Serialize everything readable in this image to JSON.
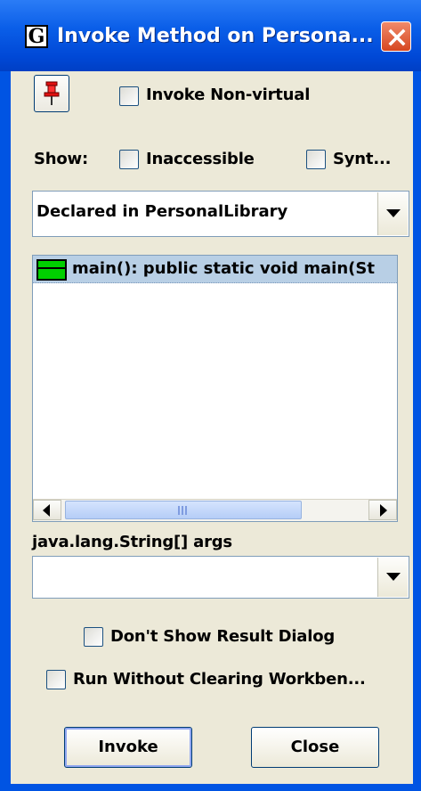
{
  "window": {
    "title": "Invoke Method on Persona...",
    "app_icon_glyph": "G"
  },
  "toolbar": {
    "pin_icon": "pushpin-icon",
    "invoke_nonvirtual_label": "Invoke Non-virtual",
    "invoke_nonvirtual_checked": false
  },
  "show": {
    "label": "Show:",
    "inaccessible_label": "Inaccessible",
    "inaccessible_checked": false,
    "synthetic_label": "Synt...",
    "synthetic_checked": false
  },
  "declared_combo": {
    "selected": "Declared in PersonalLibrary"
  },
  "methods": {
    "items": [
      {
        "icon": "method-icon",
        "label": "main():  public static void main(St"
      }
    ]
  },
  "args": {
    "label": "java.lang.String[] args",
    "value": ""
  },
  "options": {
    "dont_show_result_label": "Don't Show Result Dialog",
    "dont_show_result_checked": false,
    "run_without_clearing_label": "Run Without Clearing Workben...",
    "run_without_clearing_checked": false
  },
  "buttons": {
    "invoke": "Invoke",
    "close": "Close"
  },
  "colors": {
    "titlebar": "#0054e3",
    "dialog_bg": "#ece9d8",
    "selection": "#b8cfe5",
    "method_icon": "#00d000",
    "close_button": "#e0552f"
  }
}
